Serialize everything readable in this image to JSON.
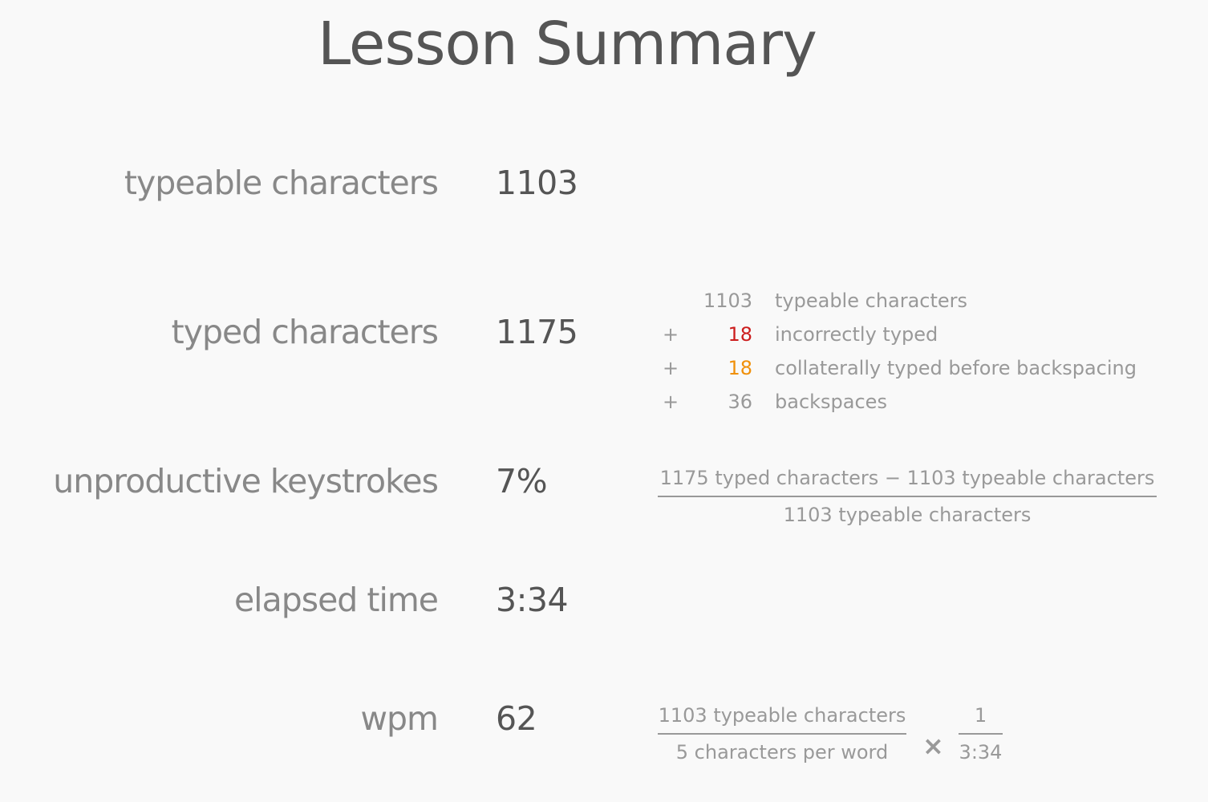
{
  "title": "Lesson Summary",
  "colors": {
    "incorrect": "#cc1d1d",
    "collateral": "#f0900a",
    "label": "#888888",
    "value": "#555555",
    "detail": "#999999"
  },
  "rows": [
    {
      "label": "typeable characters",
      "value": "1103"
    },
    {
      "label": "typed characters",
      "value": "1175"
    },
    {
      "label": "unproductive keystrokes",
      "value": "7%"
    },
    {
      "label": "elapsed time",
      "value": "3:34"
    },
    {
      "label": "wpm",
      "value": "62"
    }
  ],
  "breakdown": [
    {
      "op": "",
      "num": "1103",
      "text": "typeable characters",
      "color": "#999999"
    },
    {
      "op": "+",
      "num": "18",
      "text": "incorrectly typed",
      "color": "#cc1d1d"
    },
    {
      "op": "+",
      "num": "18",
      "text": "collaterally typed before backspacing",
      "color": "#f0900a"
    },
    {
      "op": "+",
      "num": "36",
      "text": "backspaces",
      "color": "#999999"
    }
  ],
  "unproductive_formula": {
    "numerator": "1175 typed characters − 1103 typeable characters",
    "denominator": "1103 typeable characters"
  },
  "wpm_formula": {
    "left_numerator": "1103 typeable characters",
    "left_denominator": "5 characters per word",
    "operator": "×",
    "right_numerator": "1",
    "right_denominator": "3:34"
  }
}
